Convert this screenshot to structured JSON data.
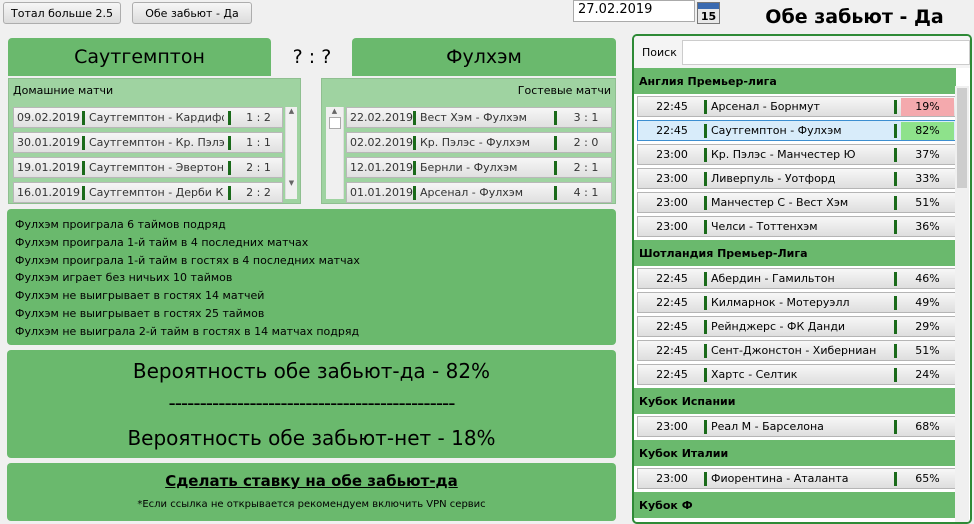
{
  "buttons": {
    "total": "Тотал больше 2.5",
    "both": "Обе забьют - Да"
  },
  "date": "27.02.2019",
  "calendar_day": "15",
  "title": "Обе забьют - Да",
  "home_team": "Саутгемптон",
  "away_team": "Фулхэм",
  "score": "? : ?",
  "home_label": "Домашние матчи",
  "away_label": "Гостевые матчи",
  "home_matches": [
    {
      "date": "09.02.2019",
      "match": "Саутгемптон - Кардифф",
      "score": "1 : 2"
    },
    {
      "date": "30.01.2019",
      "match": "Саутгемптон - Кр. Пэлэс",
      "score": "1 : 1"
    },
    {
      "date": "19.01.2019",
      "match": "Саутгемптон - Эвертон",
      "score": "2 : 1"
    },
    {
      "date": "16.01.2019",
      "match": "Саутгемптон - Дерби Ка",
      "score": "2 : 2"
    }
  ],
  "away_matches": [
    {
      "date": "22.02.2019",
      "match": "Вест Хэм - Фулхэм",
      "score": "3 : 1"
    },
    {
      "date": "02.02.2019",
      "match": "Кр. Пэлэс - Фулхэм",
      "score": "2 : 0"
    },
    {
      "date": "12.01.2019",
      "match": "Бернли - Фулхэм",
      "score": "2 : 1"
    },
    {
      "date": "01.01.2019",
      "match": "Арсенал - Фулхэм",
      "score": "4 : 1"
    }
  ],
  "facts": [
    "Фулхэм проиграла 6 таймов подряд",
    "Фулхэм проиграла 1-й тайм в 4 последних матчах",
    "Фулхэм проиграла 1-й тайм в гостях в 4 последних матчах",
    "Фулхэм играет без ничьих 10 таймов",
    "Фулхэм не выигрывает в гостях 14 матчей",
    "Фулхэм не выигрывает в гостях 25 таймов",
    "Фулхэм не выиграла 2-й тайм в гостях в 14 матчах подряд"
  ],
  "prob_yes": "Вероятность обе забьют-да - 82%",
  "prob_sep": "----------------------------------------------",
  "prob_no": "Вероятность обе забьют-нет - 18%",
  "bet_link": "Сделать ставку на обе забьют-да",
  "vpn_note": "*Если ссылка не открывается рекомендуем включить VPN сервис",
  "search_label": "Поиск",
  "leagues": [
    {
      "name": "Англия Премьер-лига",
      "games": [
        {
          "time": "22:45",
          "match": "Арсенал - Борнмут",
          "pct": "19%",
          "color": "#f4a9ad"
        },
        {
          "time": "22:45",
          "match": "Саутгемптон - Фулхэм",
          "pct": "82%",
          "color": "#8ee28b",
          "selected": true
        },
        {
          "time": "23:00",
          "match": "Кр. Пэлэс - Манчестер Ю",
          "pct": "37%"
        },
        {
          "time": "23:00",
          "match": "Ливерпуль - Уотфорд",
          "pct": "33%"
        },
        {
          "time": "23:00",
          "match": "Манчестер С - Вест Хэм",
          "pct": "51%"
        },
        {
          "time": "23:00",
          "match": "Челси - Тоттенхэм",
          "pct": "36%"
        }
      ]
    },
    {
      "name": "Шотландия Премьер-Лига",
      "games": [
        {
          "time": "22:45",
          "match": "Абердин - Гамильтон",
          "pct": "46%"
        },
        {
          "time": "22:45",
          "match": "Килмарнок - Мотеруэлл",
          "pct": "49%"
        },
        {
          "time": "22:45",
          "match": "Рейнджерс - ФК Данди",
          "pct": "29%"
        },
        {
          "time": "22:45",
          "match": "Сент-Джонстон - Хиберниан",
          "pct": "51%"
        },
        {
          "time": "22:45",
          "match": "Хартс - Селтик",
          "pct": "24%"
        }
      ]
    },
    {
      "name": "Кубок Испании",
      "games": [
        {
          "time": "23:00",
          "match": "Реал М - Барселона",
          "pct": "68%"
        }
      ]
    },
    {
      "name": "Кубок Италии",
      "games": [
        {
          "time": "23:00",
          "match": "Фиорентина - Аталанта",
          "pct": "65%"
        }
      ]
    },
    {
      "name": "Кубок Ф",
      "games": []
    }
  ]
}
